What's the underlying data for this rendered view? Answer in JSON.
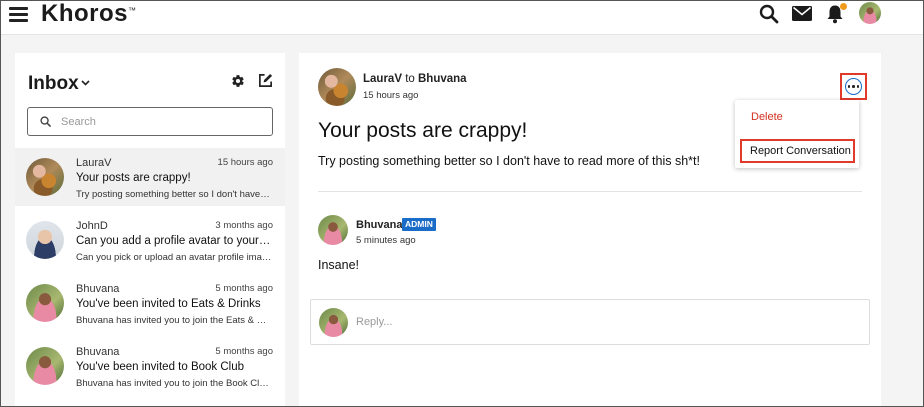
{
  "app": {
    "logo": "Khoros",
    "logo_mark": "™"
  },
  "topbar": {
    "icons": [
      "menu-icon",
      "search-icon",
      "mail-icon",
      "bell-icon"
    ],
    "notification_dot_color": "#f09a1a"
  },
  "inbox": {
    "title": "Inbox",
    "search_placeholder": "Search",
    "conversations": [
      {
        "name": "LauraV",
        "time": "15 hours ago",
        "subject": "Your posts are crappy!",
        "preview": "Try posting something better so I don't have to read more of this sh*t!",
        "active": true
      },
      {
        "name": "JohnD",
        "time": "3 months ago",
        "subject": "Can you add a profile avatar to your account?",
        "preview": "Can you pick or upload an avatar profile image?"
      },
      {
        "name": "Bhuvana",
        "time": "5 months ago",
        "subject": "You've been invited to Eats & Drinks",
        "preview": "Bhuvana has invited you to join the Eats & Drinks group"
      },
      {
        "name": "Bhuvana",
        "time": "5 months ago",
        "subject": "You've been invited to Book Club",
        "preview": "Bhuvana has invited you to join the Book Club group"
      }
    ]
  },
  "message": {
    "sender": "LauraV",
    "to_word": "to",
    "recipient": "Bhuvana",
    "time": "15 hours ago",
    "subject": "Your posts are crappy!",
    "body": "Try posting something better so I don't have to read more of this sh*t!"
  },
  "reply": {
    "name": "Bhuvana",
    "badge": "ADMIN",
    "time": "5 minutes ago",
    "body": "Insane!"
  },
  "reply_box": {
    "placeholder": "Reply..."
  },
  "menu": {
    "delete_label": "Delete",
    "report_label": "Report Conversation"
  },
  "colors": {
    "accent_blue": "#1a6cc9",
    "danger_red": "#d23020",
    "highlight_red": "#e03a2a"
  }
}
